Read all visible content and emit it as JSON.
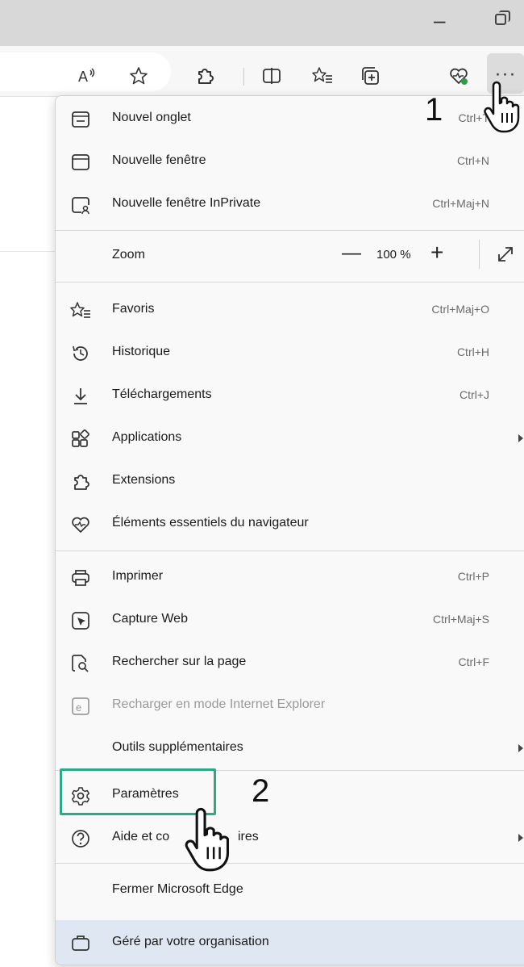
{
  "annotations": {
    "step1": "1",
    "step2": "2"
  },
  "colors": {
    "highlight": "#2fa985",
    "managed_bg": "#dfe8f2",
    "menu_bg": "#f9f9f9"
  },
  "toolbar": {
    "icons": [
      "read-aloud-icon",
      "favorite-star-icon",
      "extensions-icon",
      "split-screen-icon",
      "favorites-icon",
      "collections-icon",
      "browser-essentials-icon",
      "more-icon"
    ],
    "read_aloud_glyph": "A",
    "more_glyph": "···"
  },
  "menu": {
    "new_tab": {
      "label": "Nouvel onglet",
      "shortcut": "Ctrl+T"
    },
    "new_window": {
      "label": "Nouvelle fenêtre",
      "shortcut": "Ctrl+N"
    },
    "inprivate": {
      "label": "Nouvelle fenêtre InPrivate",
      "shortcut": "Ctrl+Maj+N"
    },
    "zoom": {
      "label": "Zoom",
      "minus": "—",
      "value": "100 %",
      "plus": "+"
    },
    "favorites": {
      "label": "Favoris",
      "shortcut": "Ctrl+Maj+O"
    },
    "history": {
      "label": "Historique",
      "shortcut": "Ctrl+H"
    },
    "downloads": {
      "label": "Téléchargements",
      "shortcut": "Ctrl+J"
    },
    "apps": {
      "label": "Applications"
    },
    "extensions": {
      "label": "Extensions"
    },
    "essentials": {
      "label": "Éléments essentiels du navigateur"
    },
    "print": {
      "label": "Imprimer",
      "shortcut": "Ctrl+P"
    },
    "web_capture": {
      "label": "Capture Web",
      "shortcut": "Ctrl+Maj+S"
    },
    "find": {
      "label": "Rechercher sur la page",
      "shortcut": "Ctrl+F"
    },
    "ie_mode": {
      "label": "Recharger en mode Internet Explorer"
    },
    "more_tools": {
      "label": "Outils supplémentaires"
    },
    "settings": {
      "label": "Paramètres"
    },
    "help": {
      "label_start": "Aide et co",
      "label_end": "ires"
    },
    "close": {
      "label": "Fermer Microsoft Edge"
    },
    "managed": {
      "label": "Géré par votre organisation"
    }
  }
}
